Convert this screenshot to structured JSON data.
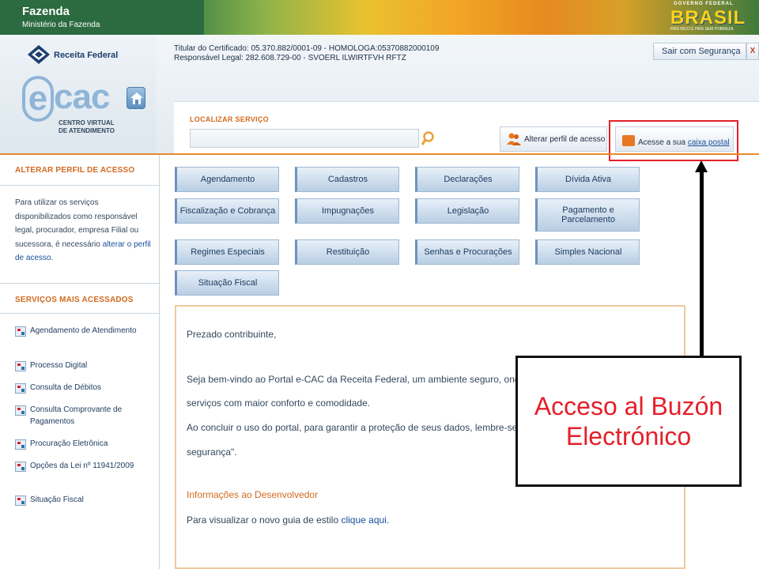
{
  "banner": {
    "org_name": "Fazenda",
    "ministry": "Ministério da Fazenda",
    "gov_small": "GOVERNO FEDERAL",
    "gov_brand": "BRASIL",
    "gov_slogan": "PAÍS RICO É PAÍS SEM POBREZA"
  },
  "header": {
    "rf_logo_text": "Receita Federal",
    "ecac_sub1": "CENTRO VIRTUAL",
    "ecac_sub2": "DE ATENDIMENTO",
    "cert_line1": "Titular do Certificado: 05.370.882/0001-09 - HOMOLOGA:05370882000109",
    "cert_line2": "Responsável Legal: 282.608.729-00 - SVOERL ILWIRTFVH RFTZ",
    "logout_label": "Sair com Segurança",
    "close_label": "X"
  },
  "search": {
    "label": "LOCALIZAR SERVIÇO",
    "value": "",
    "placeholder": ""
  },
  "actions": {
    "profile_label": "Alterar perfil de acesso",
    "mailbox_prefix": "Acesse a sua ",
    "mailbox_link": "caixa postal"
  },
  "sidebar": {
    "profile_heading": "ALTERAR PERFIL DE ACESSO",
    "profile_text": "Para utilizar os serviços disponibilizados como responsável legal, procurador, empresa Filial ou sucessora, é necessário ",
    "profile_link": "alterar o perfil de acesso",
    "profile_end": ".",
    "services_heading": "SERVIÇOS MAIS ACESSADOS",
    "services": [
      "Agendamento de Atendimento",
      "Processo Digital",
      "Consulta de Débitos",
      "Consulta Comprovante de Pagamentos",
      "Procuração Eletrônica",
      "Opções da Lei nº 11941/2009",
      "Situação Fiscal"
    ]
  },
  "service_buttons": [
    "Agendamento",
    "Cadastros",
    "Declarações",
    "Dívida Ativa",
    "Fiscalização e Cobrança",
    "Impugnações",
    "Legislação",
    "Pagamento e Parcelamento",
    "Regimes Especiais",
    "Restituição",
    "Senhas e Procurações",
    "Simples Nacional",
    "Situação Fiscal"
  ],
  "content": {
    "greeting": "Prezado contribuinte,",
    "p1_line1": "Seja bem-vindo ao Portal e-CAC da Receita Federal, um ambiente seguro, ond",
    "p1_line2": "serviços com maior conforto e comodidade.",
    "p2_line1": "Ao concluir o uso do portal, para garantir a proteção de seus dados, lembre-se",
    "p2_line2": "segurança\".",
    "dev_title": "Informações ao Desenvolvedor",
    "dev_text": "Para visualizar o novo guia de estilo ",
    "dev_link": "clique aqui",
    "dev_end": "."
  },
  "annotation": {
    "callout_text": "Acceso al Buzón Electrónico",
    "color": "#e4202a"
  }
}
